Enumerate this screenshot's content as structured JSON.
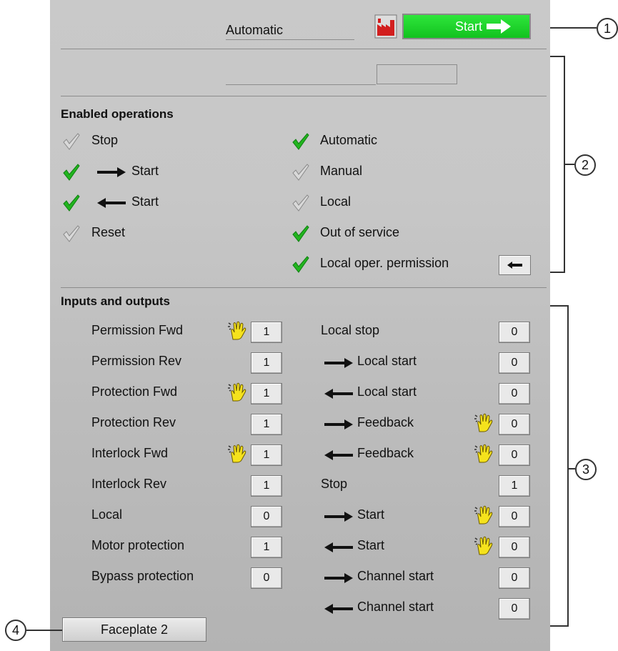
{
  "header": {
    "mode_label": "Automatic",
    "start_button": "Start",
    "start_color": "#1fd12c"
  },
  "enabled": {
    "title": "Enabled operations",
    "left": [
      {
        "label": "Stop",
        "enabled": false,
        "arrow": "none"
      },
      {
        "label": "Start",
        "enabled": true,
        "arrow": "right"
      },
      {
        "label": "Start",
        "enabled": true,
        "arrow": "left"
      },
      {
        "label": "Reset",
        "enabled": false,
        "arrow": "none"
      }
    ],
    "right": [
      {
        "label": "Automatic",
        "enabled": true
      },
      {
        "label": "Manual",
        "enabled": false
      },
      {
        "label": "Local",
        "enabled": false
      },
      {
        "label": "Out of service",
        "enabled": true
      },
      {
        "label": "Local oper. permission",
        "enabled": true
      }
    ]
  },
  "io": {
    "title": "Inputs and outputs",
    "left": [
      {
        "label": "Permission Fwd",
        "value": "1",
        "hand": true
      },
      {
        "label": "Permission Rev",
        "value": "1",
        "hand": false
      },
      {
        "label": "Protection Fwd",
        "value": "1",
        "hand": true
      },
      {
        "label": "Protection Rev",
        "value": "1",
        "hand": false
      },
      {
        "label": "Interlock Fwd",
        "value": "1",
        "hand": true
      },
      {
        "label": "Interlock Rev",
        "value": "1",
        "hand": false
      },
      {
        "label": "Local",
        "value": "0",
        "hand": false
      },
      {
        "label": "Motor protection",
        "value": "1",
        "hand": false
      },
      {
        "label": "Bypass protection",
        "value": "0",
        "hand": false
      }
    ],
    "right": [
      {
        "label": "Local stop",
        "value": "0",
        "arrow": "none",
        "hand": false
      },
      {
        "label": "Local start",
        "value": "0",
        "arrow": "right",
        "hand": false
      },
      {
        "label": "Local start",
        "value": "0",
        "arrow": "left",
        "hand": false
      },
      {
        "label": "Feedback",
        "value": "0",
        "arrow": "right",
        "hand": true
      },
      {
        "label": "Feedback",
        "value": "0",
        "arrow": "left",
        "hand": true
      },
      {
        "label": "Stop",
        "value": "1",
        "arrow": "none",
        "hand": false
      },
      {
        "label": "Start",
        "value": "0",
        "arrow": "right",
        "hand": true
      },
      {
        "label": "Start",
        "value": "0",
        "arrow": "left",
        "hand": true
      },
      {
        "label": "Channel start",
        "value": "0",
        "arrow": "right",
        "hand": false
      },
      {
        "label": "Channel start",
        "value": "0",
        "arrow": "left",
        "hand": false
      }
    ]
  },
  "footer": {
    "faceplate_button": "Faceplate 2"
  },
  "callouts": [
    "1",
    "2",
    "3",
    "4"
  ]
}
